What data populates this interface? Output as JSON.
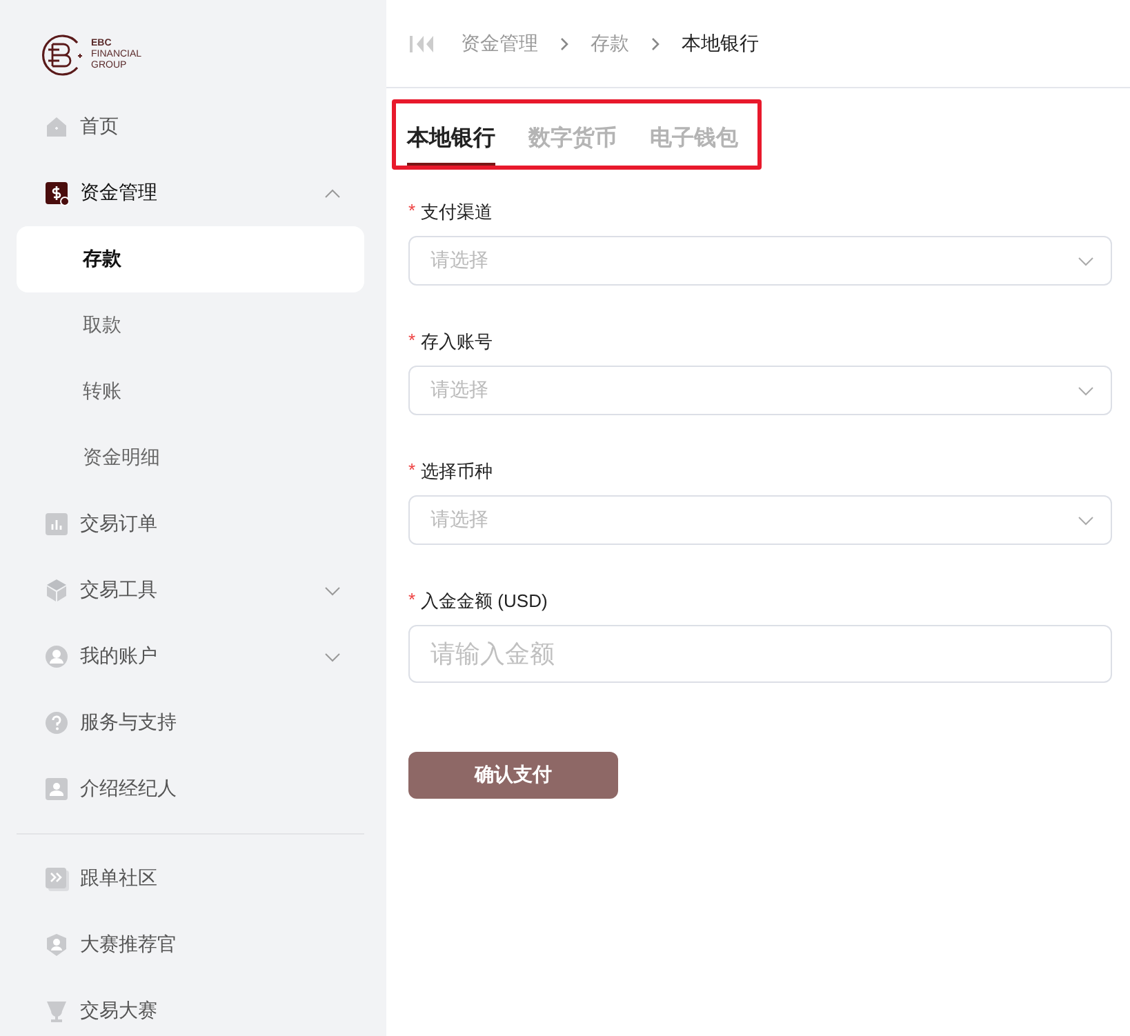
{
  "logo": {
    "lines": [
      "EBC",
      "FINANCIAL",
      "GROUP"
    ]
  },
  "nav": {
    "main": [
      {
        "label": "首页",
        "kind": "item"
      },
      {
        "label": "资金管理",
        "kind": "group",
        "expanded": true,
        "children": [
          {
            "label": "存款",
            "selected": true
          },
          {
            "label": "取款",
            "selected": false
          },
          {
            "label": "转账",
            "selected": false
          },
          {
            "label": "资金明细",
            "selected": false
          }
        ]
      },
      {
        "label": "交易订单",
        "kind": "item"
      },
      {
        "label": "交易工具",
        "kind": "group",
        "expanded": false
      },
      {
        "label": "我的账户",
        "kind": "group",
        "expanded": false
      },
      {
        "label": "服务与支持",
        "kind": "item"
      },
      {
        "label": "介绍经纪人",
        "kind": "item"
      }
    ],
    "extra": [
      {
        "label": "跟单社区",
        "kind": "item"
      },
      {
        "label": "大赛推荐官",
        "kind": "item"
      },
      {
        "label": "交易大赛",
        "kind": "item"
      }
    ]
  },
  "breadcrumb": [
    "资金管理",
    "存款",
    "本地银行"
  ],
  "tabs": {
    "highlighted": true,
    "items": [
      {
        "label": "本地银行",
        "selected": true
      },
      {
        "label": "数字货币",
        "selected": false
      },
      {
        "label": "电子钱包",
        "selected": false
      }
    ]
  },
  "form": {
    "fields": [
      {
        "kind": "select",
        "label": "支付渠道",
        "required_mark": "*",
        "placeholder": "请选择"
      },
      {
        "kind": "select",
        "label": "存入账号",
        "required_mark": "*",
        "placeholder": "请选择"
      },
      {
        "kind": "select",
        "label": "选择币种",
        "required_mark": "*",
        "placeholder": "请选择"
      },
      {
        "kind": "input",
        "label": "入金金额 (USD)",
        "required_mark": "*",
        "placeholder": "请输入金额"
      }
    ],
    "submit": "确认支付"
  }
}
